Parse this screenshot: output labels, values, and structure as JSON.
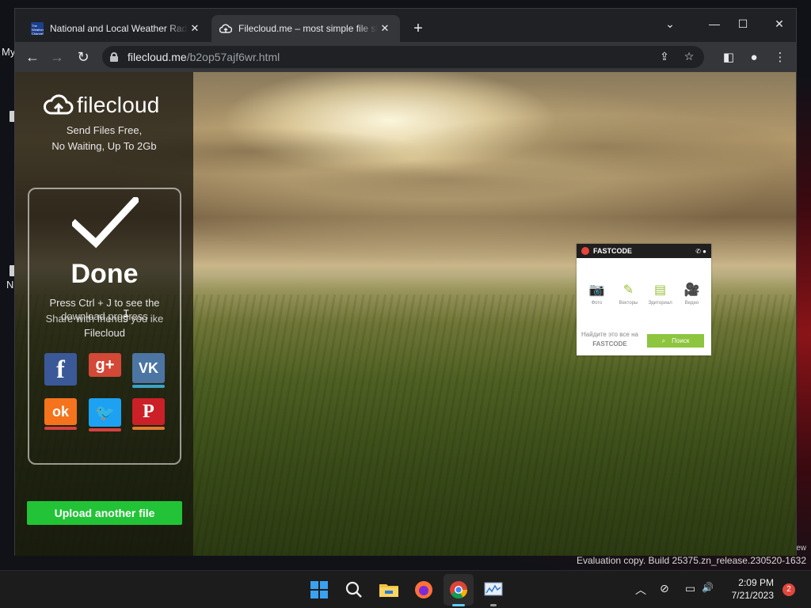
{
  "desktop": {
    "label_my": "My",
    "label_n": "N",
    "evaluation_text": "Evaluation copy. Build 25375.zn_release.230520-1632",
    "edge_text": "ew"
  },
  "browser": {
    "tabs": [
      {
        "title": "National and Local Weather Radar",
        "favicon": "weather-channel-icon",
        "favicon_text": "The Weather Channel",
        "active": false
      },
      {
        "title": "Filecloud.me – most simple file sharing",
        "favicon": "cloud-upload-icon",
        "active": true
      }
    ],
    "tab_close_glyph": "✕",
    "new_tab_glyph": "+",
    "window_controls": {
      "menu": "⌄",
      "minimize": "—",
      "maximize": "☐",
      "close": "✕"
    },
    "nav": {
      "back": "←",
      "forward": "→",
      "reload": "↻"
    },
    "url": {
      "host": "filecloud.me",
      "path": "/b2op57ajf6wr.html"
    },
    "omnibox_icons": {
      "share": "⇪",
      "bookmark": "☆"
    },
    "toolbar_icons": {
      "side_panel": "◧",
      "profile": "●",
      "menu": "⋮"
    }
  },
  "page": {
    "logo_text": "filecloud",
    "tagline_line1": "Send Files Free,",
    "tagline_line2": "No Waiting, Up To 2Gb",
    "done_title": "Done",
    "ctrl_j_line1": "Press Ctrl + J to see the",
    "ctrl_j_line2": "download progress",
    "share_line1": "Share with friends you ike",
    "share_line2": "Filecloud",
    "social": [
      {
        "name": "facebook",
        "glyph": "f",
        "color": "#3b5998"
      },
      {
        "name": "google-plus",
        "glyph": "g+",
        "color": "#d34836"
      },
      {
        "name": "vk",
        "glyph": "VK",
        "color": "#4c75a3"
      },
      {
        "name": "odnoklassniki",
        "glyph": "ok",
        "color": "#f4731c"
      },
      {
        "name": "twitter",
        "glyph": "🐦",
        "color": "#1da1f2"
      },
      {
        "name": "pinterest",
        "glyph": "P",
        "color": "#cb2027"
      }
    ],
    "upload_button": "Upload another file"
  },
  "ad": {
    "brand": "FASTCODE",
    "items": [
      {
        "label": "Фото",
        "icon": "camera-icon",
        "glyph": "📷"
      },
      {
        "label": "Векторы",
        "icon": "pen-icon",
        "glyph": "✎"
      },
      {
        "label": "Эдиториал",
        "icon": "newspaper-icon",
        "glyph": "▤"
      },
      {
        "label": "Видео",
        "icon": "video-icon",
        "glyph": "🎥"
      }
    ],
    "footer_line1": "Найдите это все на",
    "footer_line2": "FASTCODE",
    "search_button": "Поиск"
  },
  "taskbar": {
    "apps": [
      "start-icon",
      "search-icon",
      "file-explorer-icon",
      "firefox-icon",
      "chrome-icon",
      "performance-monitor-icon"
    ],
    "tray": {
      "chevron": "︿",
      "network": "⊘",
      "display": "▭",
      "volume": "🔊"
    },
    "time": "2:09 PM",
    "date": "7/21/2023",
    "notification_count": "2",
    "accent": "#60cdff"
  }
}
